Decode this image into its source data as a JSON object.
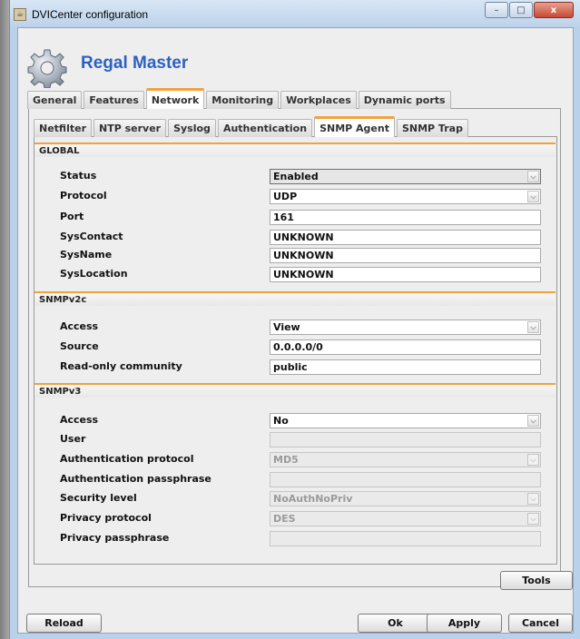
{
  "window": {
    "title": "DVICenter configuration",
    "min_glyph": "–",
    "max_glyph": "□",
    "close_glyph": "x"
  },
  "header": {
    "app_name": "Regal Master"
  },
  "main_tabs": [
    "General",
    "Features",
    "Network",
    "Monitoring",
    "Workplaces",
    "Dynamic ports"
  ],
  "active_main_tab": "Network",
  "sub_tabs": [
    "Netfilter",
    "NTP server",
    "Syslog",
    "Authentication",
    "SNMP Agent",
    "SNMP Trap"
  ],
  "active_sub_tab": "SNMP Agent",
  "global": {
    "heading": "GLOBAL",
    "status_label": "Status",
    "status_value": "Enabled",
    "protocol_label": "Protocol",
    "protocol_value": "UDP",
    "port_label": "Port",
    "port_value": "161",
    "syscontact_label": "SysContact",
    "syscontact_value": "UNKNOWN",
    "sysname_label": "SysName",
    "sysname_value": "UNKNOWN",
    "syslocation_label": "SysLocation",
    "syslocation_value": "UNKNOWN"
  },
  "snmpv2c": {
    "heading": "SNMPv2c",
    "access_label": "Access",
    "access_value": "View",
    "source_label": "Source",
    "source_value": "0.0.0.0/0",
    "community_label": "Read-only community",
    "community_value": "public"
  },
  "snmpv3": {
    "heading": "SNMPv3",
    "access_label": "Access",
    "access_value": "No",
    "user_label": "User",
    "user_value": "",
    "auth_protocol_label": "Authentication protocol",
    "auth_protocol_value": "MD5",
    "auth_pass_label": "Authentication passphrase",
    "auth_pass_value": "",
    "security_level_label": "Security level",
    "security_level_value": "NoAuthNoPriv",
    "privacy_protocol_label": "Privacy protocol",
    "privacy_protocol_value": "DES",
    "privacy_pass_label": "Privacy passphrase",
    "privacy_pass_value": ""
  },
  "buttons": {
    "tools": "Tools",
    "reload": "Reload",
    "ok": "Ok",
    "apply": "Apply",
    "cancel": "Cancel"
  },
  "colors": {
    "accent": "#f0a33a",
    "title_blue": "#2b61c4"
  }
}
